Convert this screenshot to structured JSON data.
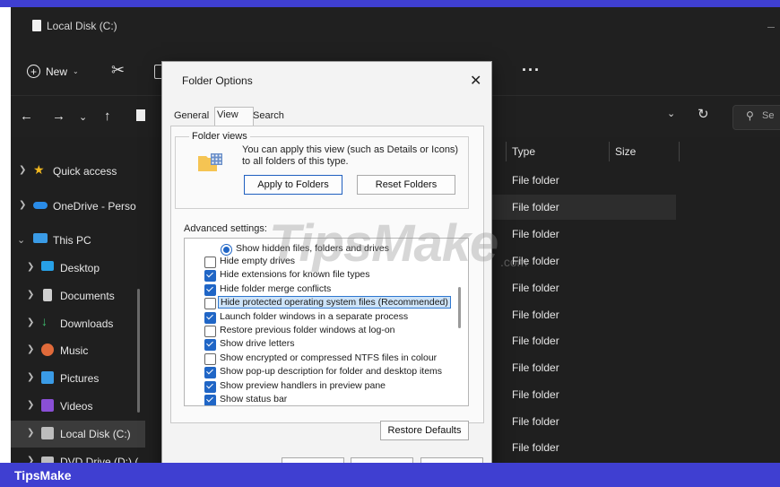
{
  "explorer": {
    "window_title": "Local Disk (C:)",
    "toolbar": {
      "new_label": "New"
    },
    "search_placeholder": "Se",
    "sidebar": [
      {
        "label": "Quick access",
        "icon": "star-icon",
        "color": "#f2b81f"
      },
      {
        "label": "OneDrive - Perso",
        "icon": "cloud-icon",
        "color": "#2a8ce8"
      },
      {
        "label": "This PC",
        "icon": "monitor-icon",
        "color": "#3a9be6"
      },
      {
        "label": "Desktop",
        "icon": "desktop-icon",
        "color": "#27a0e6"
      },
      {
        "label": "Documents",
        "icon": "document-icon",
        "color": "#cfcfcf"
      },
      {
        "label": "Downloads",
        "icon": "download-icon",
        "color": "#3fbf6f"
      },
      {
        "label": "Music",
        "icon": "music-icon",
        "color": "#e06a3a"
      },
      {
        "label": "Pictures",
        "icon": "pictures-icon",
        "color": "#3a9be6"
      },
      {
        "label": "Videos",
        "icon": "videos-icon",
        "color": "#8a4fd6"
      },
      {
        "label": "Local Disk (C:)",
        "icon": "drive-icon",
        "color": "#bdbdbd"
      },
      {
        "label": "DVD Drive (D:) (",
        "icon": "dvd-icon",
        "color": "#bdbdbd"
      }
    ],
    "columns": {
      "type": "Type",
      "size": "Size"
    },
    "rows": [
      "File folder",
      "File folder",
      "File folder",
      "File folder",
      "File folder",
      "File folder",
      "File folder",
      "File folder",
      "File folder",
      "File folder",
      "File folder",
      "File folder"
    ]
  },
  "dialog": {
    "title": "Folder Options",
    "tabs": [
      "General",
      "View",
      "Search"
    ],
    "selected_tab": "View",
    "folder_views": {
      "group_label": "Folder views",
      "description": "You can apply this view (such as Details or Icons) to all folders of this type.",
      "apply_button": "Apply to Folders",
      "reset_button": "Reset Folders"
    },
    "advanced_label": "Advanced settings:",
    "radio_option": "Show hidden files, folders and drives",
    "options": [
      {
        "label": "Hide empty drives",
        "checked": false
      },
      {
        "label": "Hide extensions for known file types",
        "checked": true
      },
      {
        "label": "Hide folder merge conflicts",
        "checked": true
      },
      {
        "label": "Hide protected operating system files (Recommended)",
        "checked": false,
        "selected": true
      },
      {
        "label": "Launch folder windows in a separate process",
        "checked": true
      },
      {
        "label": "Restore previous folder windows at log-on",
        "checked": false
      },
      {
        "label": "Show drive letters",
        "checked": true
      },
      {
        "label": "Show encrypted or compressed NTFS files in colour",
        "checked": false
      },
      {
        "label": "Show pop-up description for folder and desktop items",
        "checked": true
      },
      {
        "label": "Show preview handlers in preview pane",
        "checked": true
      },
      {
        "label": "Show status bar",
        "checked": true
      }
    ],
    "restore_defaults": "Restore Defaults"
  },
  "watermark": {
    "main": "TipsMake",
    "sub": ".com"
  },
  "footer_brand": "TipsMake",
  "colors": {
    "brand_bar": "#3f3fd1",
    "accent": "#2066c6"
  }
}
